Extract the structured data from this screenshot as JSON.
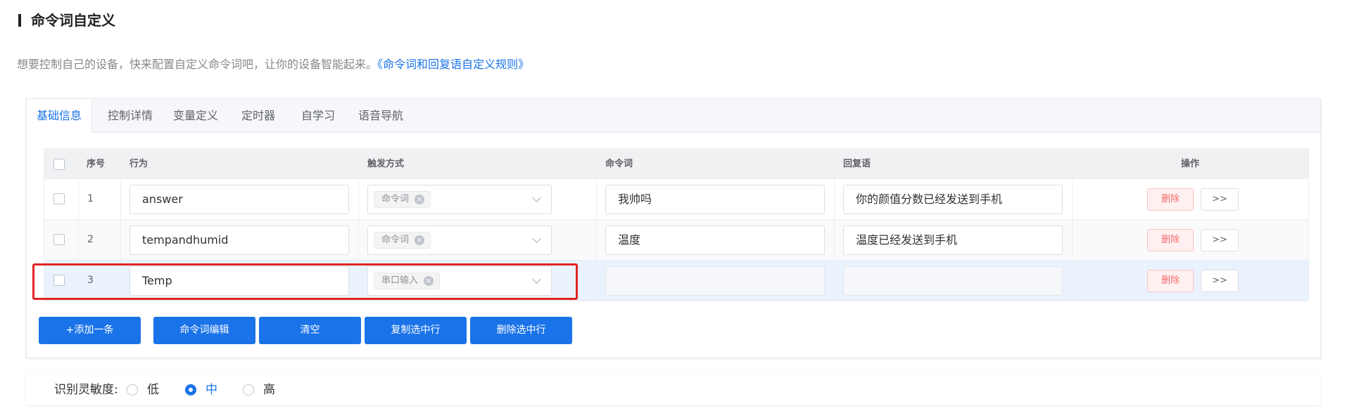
{
  "header": {
    "title": "命令词自定义"
  },
  "description": {
    "text": "想要控制自己的设备，快来配置自定义命令词吧，让你的设备智能起来。",
    "link": "《命令词和回复语自定义规则》"
  },
  "tabs": [
    {
      "label": "基础信息",
      "active": true
    },
    {
      "label": "控制详情"
    },
    {
      "label": "变量定义"
    },
    {
      "label": "定时器"
    },
    {
      "label": "自学习"
    },
    {
      "label": "语音导航"
    }
  ],
  "table": {
    "headers": {
      "index": "序号",
      "action": "行为",
      "trigger": "触发方式",
      "command": "命令词",
      "reply": "回复语",
      "ops": "操作"
    },
    "rows": [
      {
        "index": "1",
        "action": "answer",
        "trigger": "命令词",
        "command": "我帅吗",
        "reply": "你的颜值分数已经发送到手机",
        "delete": "删除",
        "more": ">>"
      },
      {
        "index": "2",
        "action": "tempandhumid",
        "trigger": "命令词",
        "command": "温度",
        "reply": "温度已经发送到手机",
        "delete": "删除",
        "more": ">>"
      },
      {
        "index": "3",
        "action": "Temp",
        "trigger": "串口输入",
        "command": "",
        "reply": "",
        "delete": "删除",
        "more": ">>",
        "selected": true
      }
    ]
  },
  "buttons": {
    "add": "+添加一条",
    "edit_commands": "命令词编辑",
    "clear": "清空",
    "copy_selected": "复制选中行",
    "delete_selected": "删除选中行"
  },
  "sensitivity": {
    "label": "识别灵敏度:",
    "options": [
      "低",
      "中",
      "高"
    ],
    "selected": "中"
  },
  "colors": {
    "primary": "#1a73e8",
    "danger": "#f56c6c",
    "highlight": "#e02424"
  }
}
